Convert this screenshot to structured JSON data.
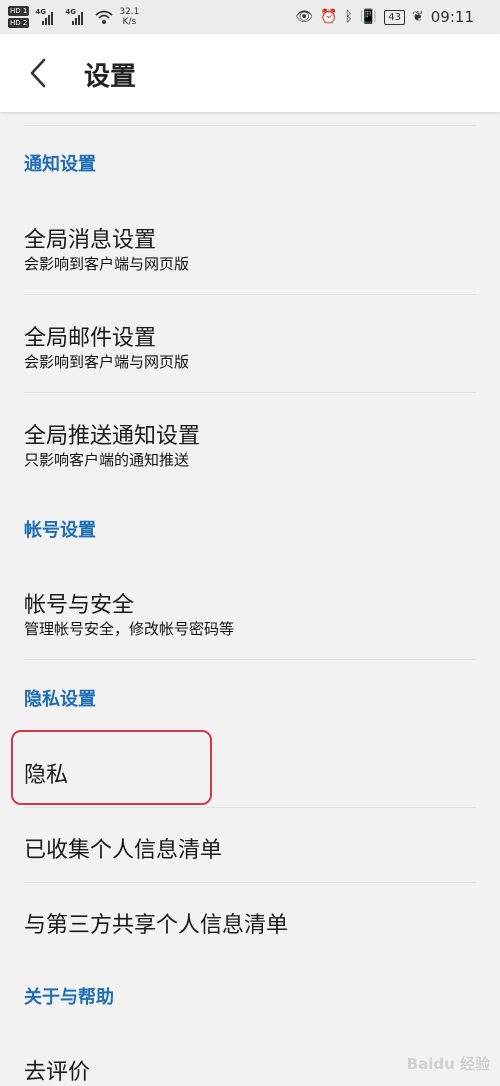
{
  "statusbar": {
    "sim1": "HD 1",
    "sim2": "HD 2",
    "net1": "4G",
    "net2": "4G",
    "speed_value": "32.1",
    "speed_unit": "K/s",
    "battery": "43",
    "time": "09:11"
  },
  "header": {
    "title": "设置"
  },
  "sections": {
    "notify": "通知设置",
    "account": "帐号设置",
    "privacy": "隐私设置",
    "about": "关于与帮助"
  },
  "items": {
    "global_message": {
      "title": "全局消息设置",
      "subtitle": "会影响到客户端与网页版"
    },
    "global_mail": {
      "title": "全局邮件设置",
      "subtitle": "会影响到客户端与网页版"
    },
    "global_push": {
      "title": "全局推送通知设置",
      "subtitle": "只影响客户端的通知推送"
    },
    "account_security": {
      "title": "帐号与安全",
      "subtitle": "管理帐号安全，修改帐号密码等"
    },
    "privacy": {
      "title": "隐私"
    },
    "collected_info": {
      "title": "已收集个人信息清单"
    },
    "shared_info": {
      "title": "与第三方共享个人信息清单"
    },
    "rate": {
      "title": "去评价"
    }
  },
  "watermark": "Baidu 经验",
  "colors": {
    "section_blue": "#1e6fb6",
    "highlight_red": "#d23a48",
    "background": "#f2f2f2"
  }
}
